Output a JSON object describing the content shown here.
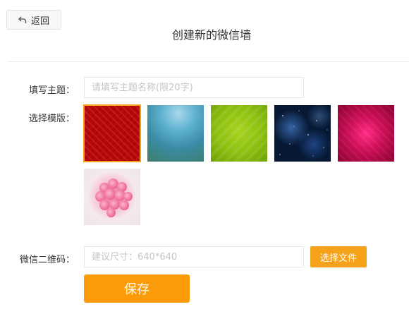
{
  "header": {
    "back_label": "返回",
    "title": "创建新的微信墙"
  },
  "form": {
    "topic": {
      "label": "填写主题：",
      "value": "",
      "placeholder": "请填写主题名称(限20字)"
    },
    "template": {
      "label": "选择模版：",
      "selected_index": 0,
      "options": [
        {
          "name": "red-pattern",
          "color": "#b5070c"
        },
        {
          "name": "teal-blur",
          "color": "#4a9fbf"
        },
        {
          "name": "green-stripes",
          "color": "#8cbf10"
        },
        {
          "name": "blue-space",
          "color": "#061833"
        },
        {
          "name": "pink-glow",
          "color": "#d0105a"
        },
        {
          "name": "pink-roses",
          "color": "#f07ca0"
        }
      ]
    },
    "qrcode": {
      "label": "微信二维码：",
      "value": "",
      "placeholder": "建议尺寸：640*640",
      "file_button_label": "选择文件"
    },
    "save_label": "保存"
  },
  "icons": {
    "back": "undo-arrow-icon"
  },
  "colors": {
    "accent": "#f5a21a",
    "save": "#fb9b0a",
    "divider": "#ececec"
  }
}
